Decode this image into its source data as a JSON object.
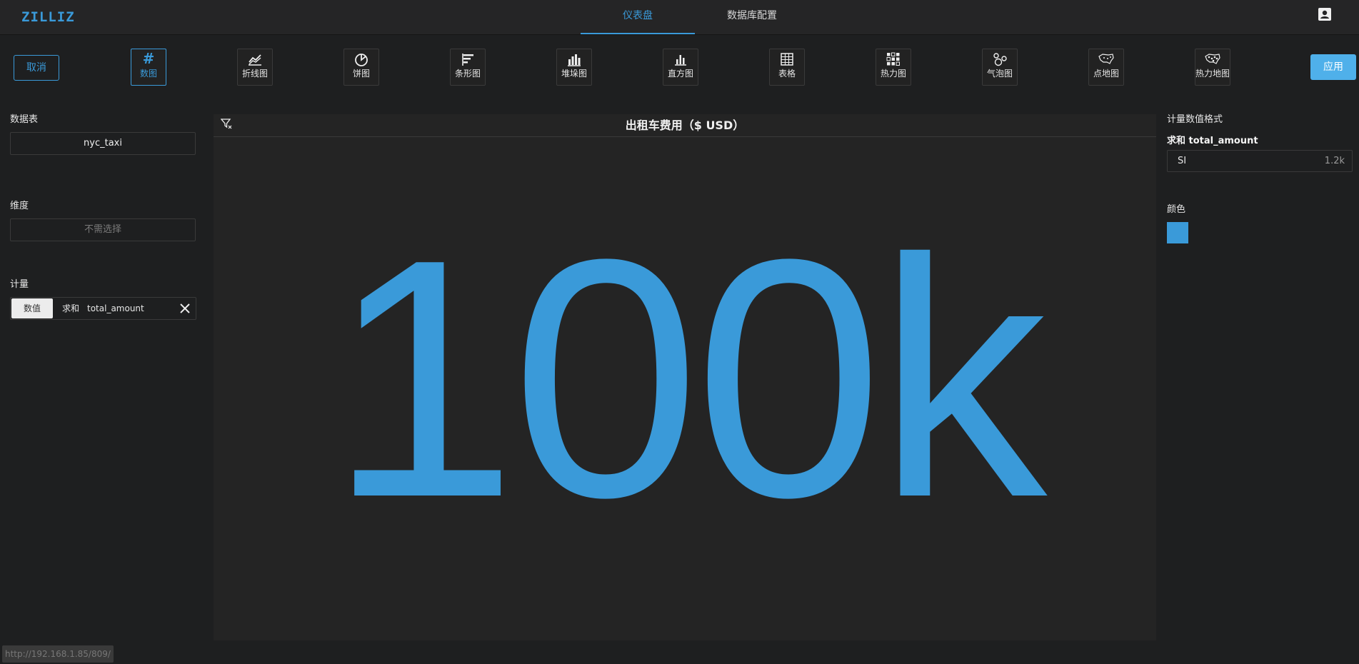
{
  "app": {
    "logo": "ZILLIZ"
  },
  "nav": {
    "tabs": [
      {
        "label": "仪表盘",
        "active": true
      },
      {
        "label": "数据库配置",
        "active": false
      }
    ]
  },
  "toolbar": {
    "cancel_label": "取消",
    "apply_label": "应用",
    "chart_types": [
      {
        "label": "数图",
        "icon": "hash-icon",
        "selected": true
      },
      {
        "label": "折线图",
        "icon": "line-chart-icon"
      },
      {
        "label": "饼图",
        "icon": "pie-chart-icon"
      },
      {
        "label": "条形图",
        "icon": "bar-chart-icon"
      },
      {
        "label": "堆垛图",
        "icon": "stacked-chart-icon"
      },
      {
        "label": "直方图",
        "icon": "histogram-icon"
      },
      {
        "label": "表格",
        "icon": "table-icon"
      },
      {
        "label": "热力图",
        "icon": "heatmap-icon"
      },
      {
        "label": "气泡图",
        "icon": "bubble-chart-icon"
      },
      {
        "label": "点地图",
        "icon": "point-map-icon"
      },
      {
        "label": "热力地图",
        "icon": "heat-map-geo-icon"
      }
    ],
    "number_glyph": "#"
  },
  "left": {
    "table_title": "数据表",
    "table_value": "nyc_taxi",
    "dimension_title": "维度",
    "dimension_placeholder": "不需选择",
    "measure_title": "计量",
    "measure": {
      "tag": "数值",
      "agg": "求和",
      "field": "total_amount"
    }
  },
  "chart": {
    "title": "出租车费用（$ USD）",
    "value_display": "100k"
  },
  "right": {
    "format_title": "计量数值格式",
    "measure_label": "求和 total_amount",
    "format_selected": "SI",
    "format_example": "1.2k",
    "color_title": "颜色",
    "color_value": "#3a9ad9"
  },
  "status": {
    "url": "http://192.168.1.85/809/"
  },
  "colors": {
    "accent": "#3a9ad9",
    "apply_bg": "#4fb0ea",
    "background": "#1e1f20"
  }
}
